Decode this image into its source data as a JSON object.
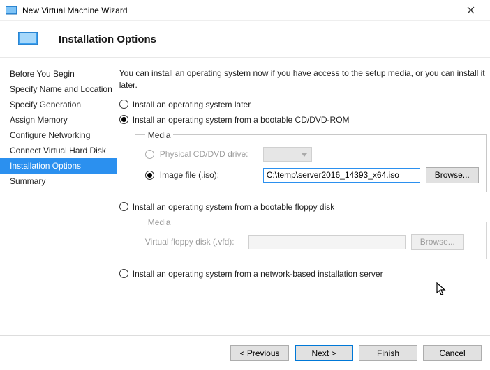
{
  "window": {
    "title": "New Virtual Machine Wizard"
  },
  "page": {
    "heading": "Installation Options",
    "intro": "You can install an operating system now if you have access to the setup media, or you can install it later."
  },
  "sidebar": {
    "steps": [
      "Before You Begin",
      "Specify Name and Location",
      "Specify Generation",
      "Assign Memory",
      "Configure Networking",
      "Connect Virtual Hard Disk",
      "Installation Options",
      "Summary"
    ],
    "active_index": 6
  },
  "options": {
    "later": "Install an operating system later",
    "cd": "Install an operating system from a bootable CD/DVD-ROM",
    "floppy": "Install an operating system from a bootable floppy disk",
    "network": "Install an operating system from a network-based installation server",
    "selected": 1
  },
  "media_cd": {
    "legend": "Media",
    "physical_label": "Physical CD/DVD drive:",
    "image_label": "Image file (.iso):",
    "image_value": "C:\\temp\\server2016_14393_x64.iso",
    "browse": "Browse...",
    "sub_selected": 1
  },
  "media_floppy": {
    "legend": "Media",
    "vfd_label": "Virtual floppy disk (.vfd):",
    "browse": "Browse..."
  },
  "footer": {
    "previous": "< Previous",
    "next": "Next >",
    "finish": "Finish",
    "cancel": "Cancel"
  }
}
